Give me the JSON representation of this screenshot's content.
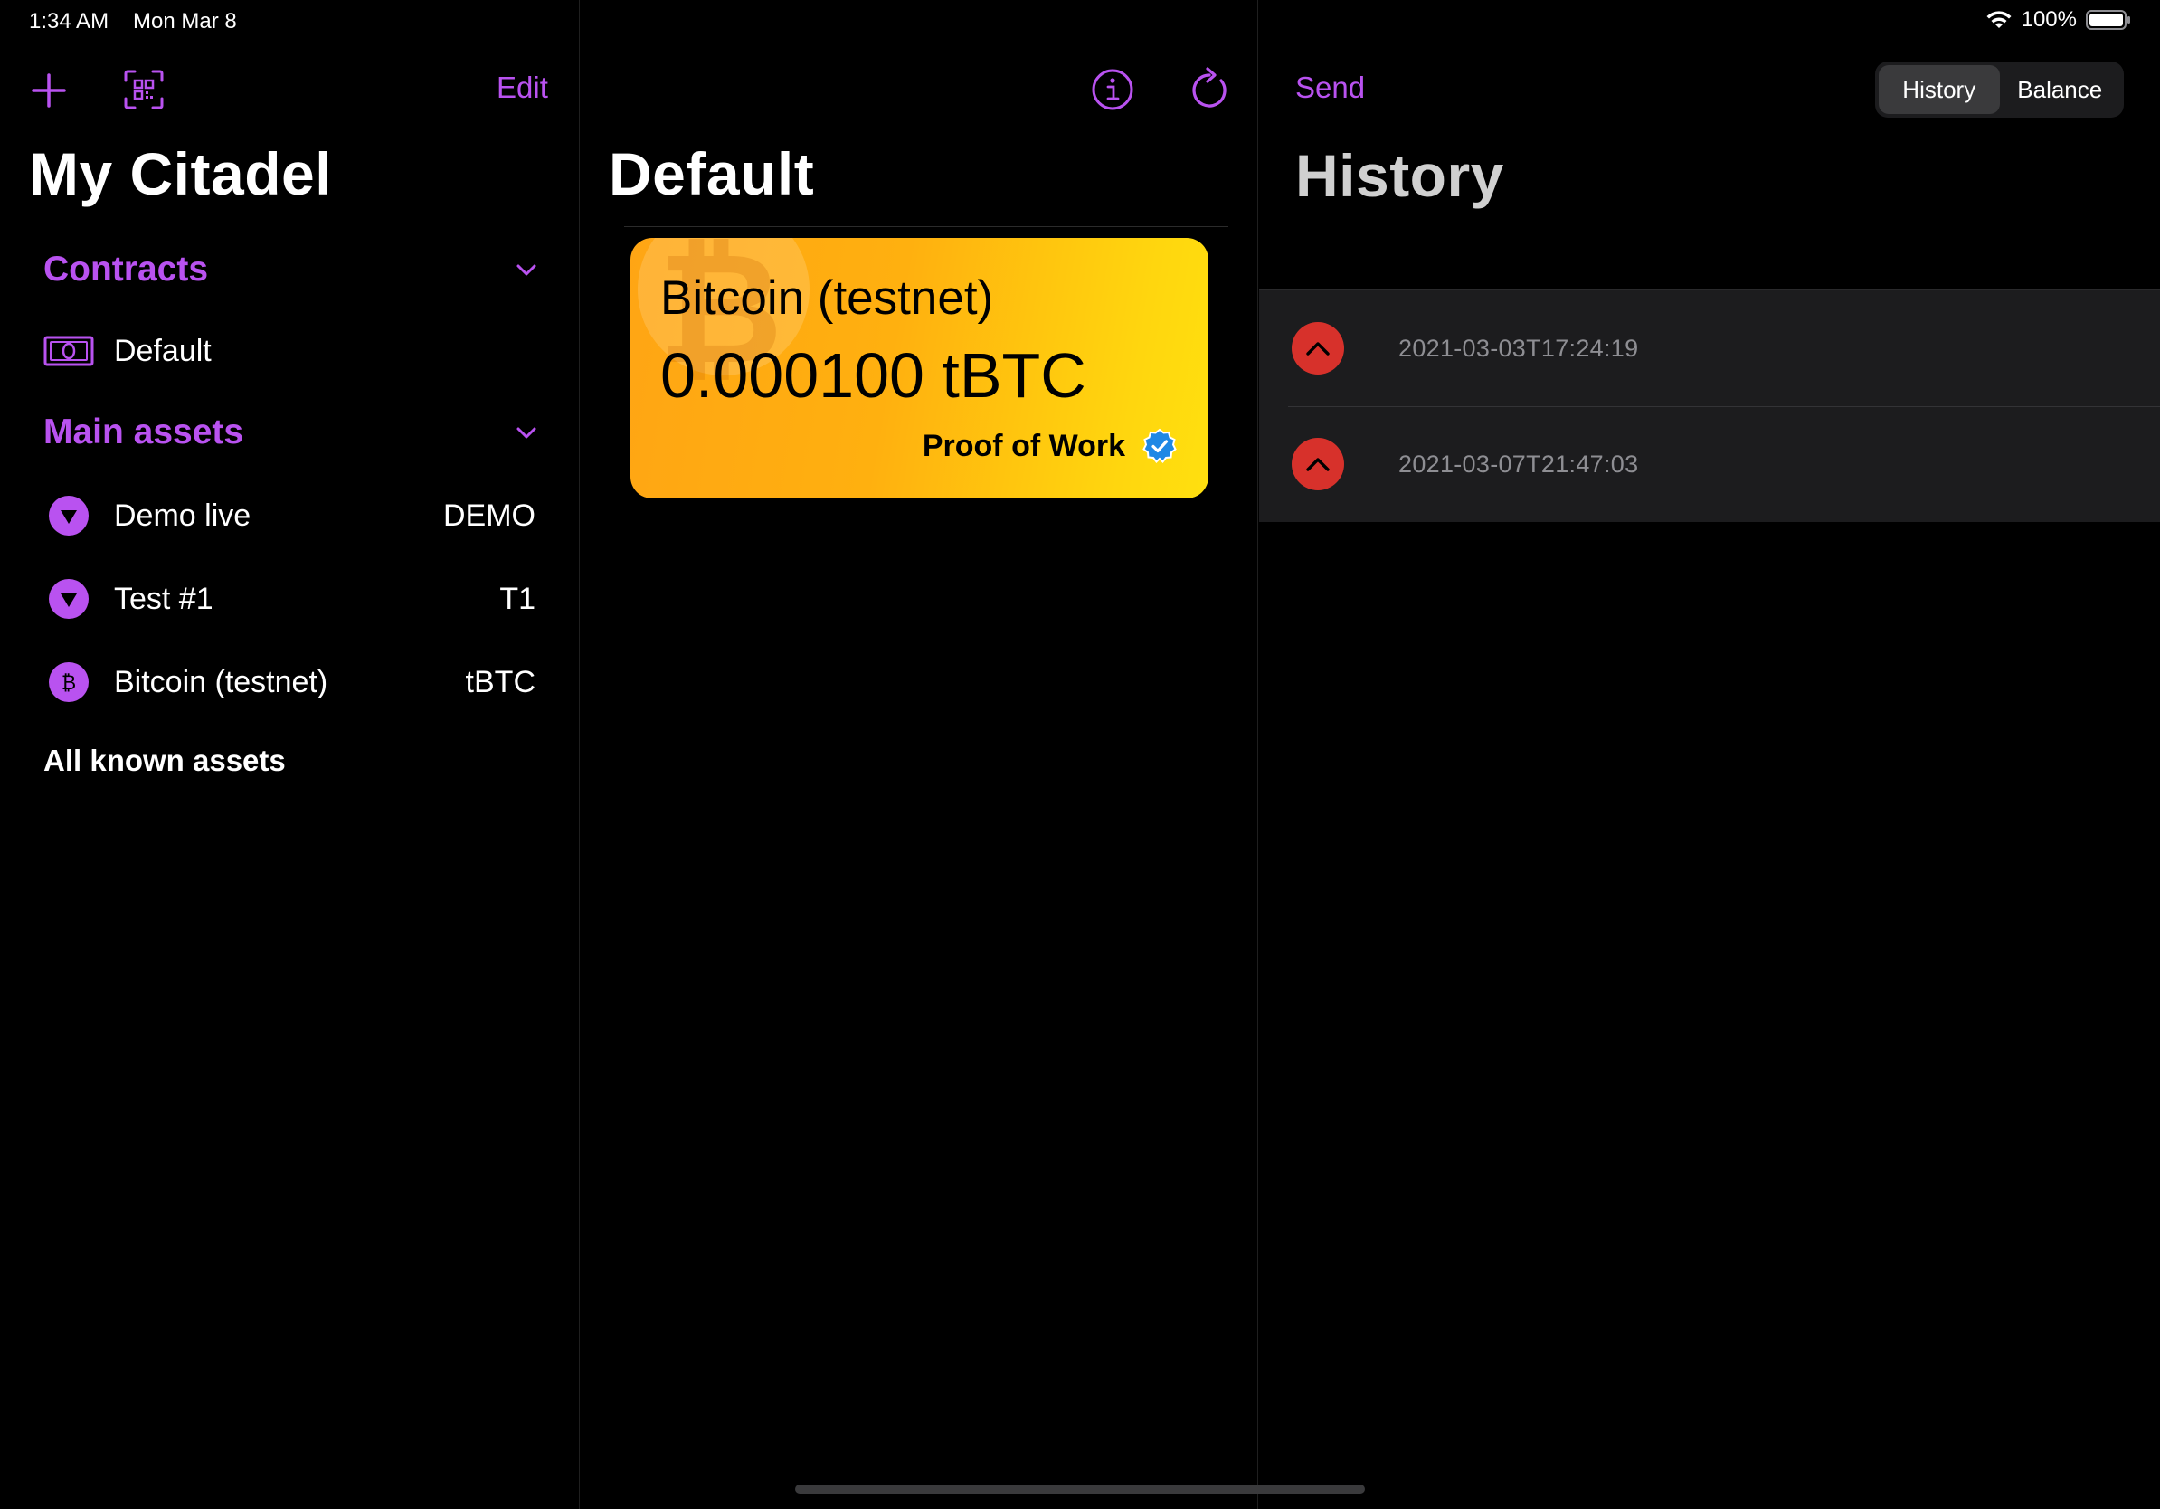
{
  "status_bar": {
    "time": "1:34 AM",
    "date": "Mon Mar 8",
    "battery": "100%"
  },
  "sidebar": {
    "edit_label": "Edit",
    "title": "My Citadel",
    "contracts_header": "Contracts",
    "contracts": [
      {
        "label": "Default",
        "icon": "wallet-icon"
      }
    ],
    "assets_header": "Main assets",
    "assets": [
      {
        "label": "Demo live",
        "ticker": "DEMO",
        "icon": "triangle-down-icon"
      },
      {
        "label": "Test #1",
        "ticker": "T1",
        "icon": "triangle-down-icon"
      },
      {
        "label": "Bitcoin (testnet)",
        "ticker": "tBTC",
        "icon": "bitcoin-icon"
      }
    ],
    "all_known_label": "All known assets"
  },
  "middle": {
    "title": "Default",
    "card": {
      "name": "Bitcoin (testnet)",
      "amount": "0.000100 tBTC",
      "consensus": "Proof of Work",
      "colors": {
        "start": "#ffa514",
        "end": "#ffe00f"
      }
    }
  },
  "right": {
    "send_label": "Send",
    "segments": [
      "History",
      "Balance"
    ],
    "selected_segment": "History",
    "title": "History",
    "transactions": [
      {
        "date": "2021-03-03T17:24:19",
        "direction": "outgoing"
      },
      {
        "date": "2021-03-07T21:47:03",
        "direction": "outgoing"
      }
    ]
  },
  "colors": {
    "accent": "#b952f0",
    "background": "#000000",
    "outgoing": "#d7312b"
  }
}
